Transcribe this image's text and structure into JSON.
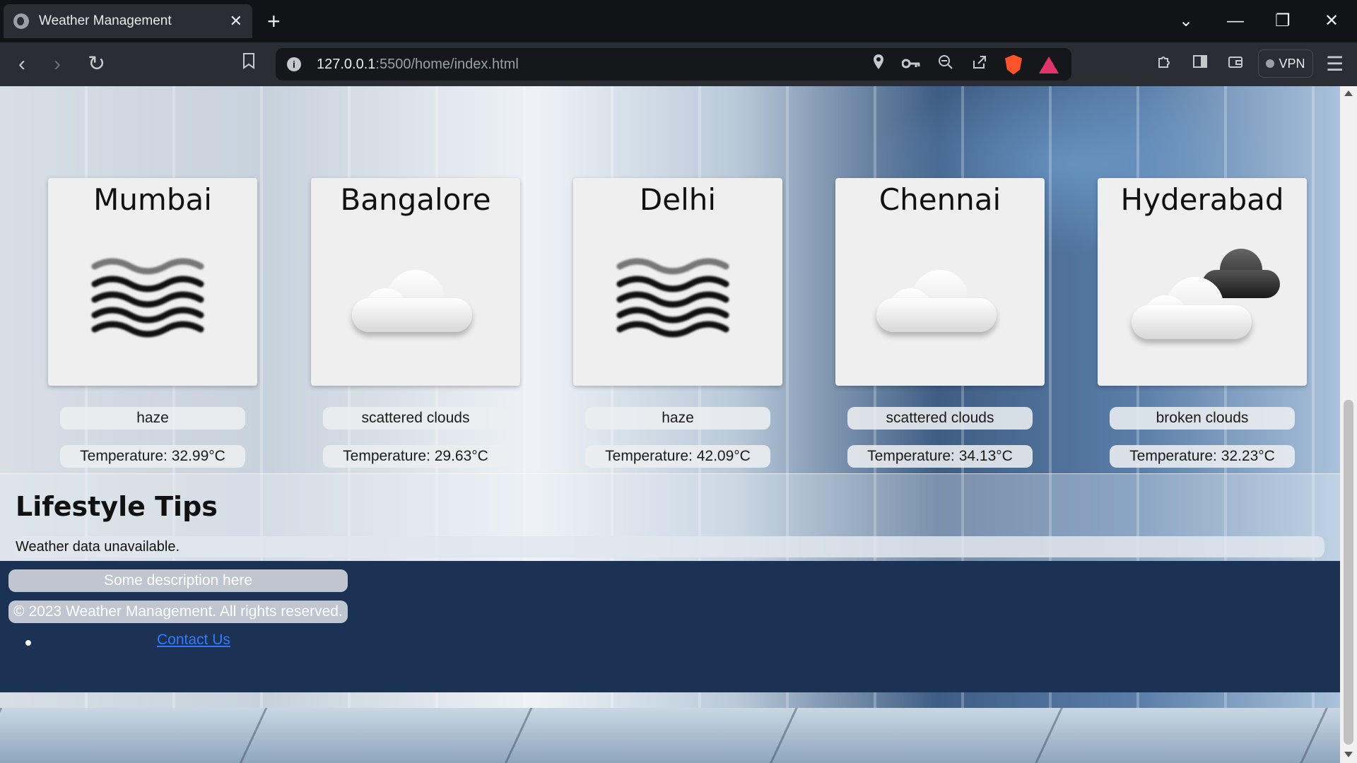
{
  "browser": {
    "tab_title": "Weather Management",
    "tab_close": "✕",
    "new_tab": "+",
    "url_host": "127.0.0.1",
    "url_path": ":5500/home/index.html",
    "vpn_label": "VPN",
    "controls": {
      "tab_list": "⌄",
      "minimize": "—",
      "restore": "❐",
      "close": "✕"
    },
    "nav": {
      "back": "‹",
      "forward": "›",
      "reload": "↻",
      "bookmark": "🔖"
    }
  },
  "cities": [
    {
      "name": "Mumbai",
      "icon": "haze-icon",
      "description": "haze",
      "temperature": "Temperature: 32.99°C"
    },
    {
      "name": "Bangalore",
      "icon": "cloud-icon",
      "description": "scattered clouds",
      "temperature": "Temperature: 29.63°C"
    },
    {
      "name": "Delhi",
      "icon": "haze-icon",
      "description": "haze",
      "temperature": "Temperature: 42.09°C"
    },
    {
      "name": "Chennai",
      "icon": "cloud-icon",
      "description": "scattered clouds",
      "temperature": "Temperature: 34.13°C"
    },
    {
      "name": "Hyderabad",
      "icon": "broken-clouds-icon",
      "description": "broken clouds",
      "temperature": "Temperature: 32.23°C"
    }
  ],
  "tips": {
    "heading": "Lifestyle Tips",
    "message": "Weather data unavailable."
  },
  "footer": {
    "description": "Some description here",
    "copyright": "© 2023 Weather Management. All rights reserved.",
    "contact": "Contact Us"
  },
  "colors": {
    "footer_bg": "#1c3255",
    "link": "#2f7bff",
    "card_bg": "#efefef"
  }
}
